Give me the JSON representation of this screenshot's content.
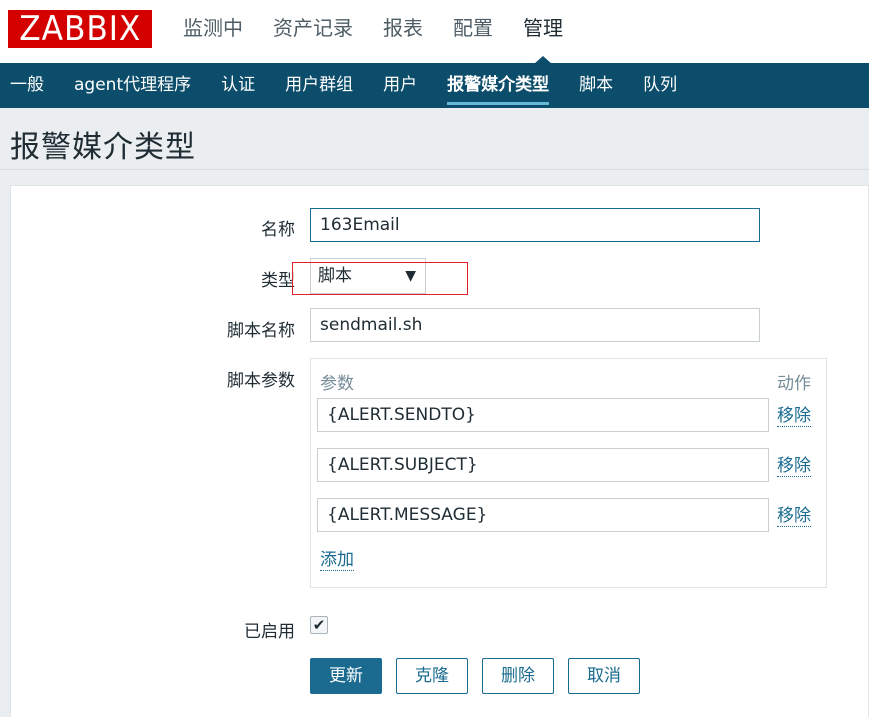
{
  "header": {
    "logo": "ZABBIX",
    "menu": [
      "监测中",
      "资产记录",
      "报表",
      "配置",
      "管理"
    ],
    "active_menu": "管理"
  },
  "subnav": {
    "items": [
      "一般",
      "agent代理程序",
      "认证",
      "用户群组",
      "用户",
      "报警媒介类型",
      "脚本",
      "队列"
    ],
    "active": "报警媒介类型"
  },
  "page": {
    "title": "报警媒介类型"
  },
  "form": {
    "name_label": "名称",
    "name_value": "163Email",
    "type_label": "类型",
    "type_value": "脚本",
    "script_name_label": "脚本名称",
    "script_name_value": "sendmail.sh",
    "script_params_label": "脚本参数",
    "params_col_header": "参数",
    "action_col_header": "动作",
    "params": [
      {
        "value": "{ALERT.SENDTO}",
        "action": "移除"
      },
      {
        "value": "{ALERT.SUBJECT}",
        "action": "移除"
      },
      {
        "value": "{ALERT.MESSAGE}",
        "action": "移除"
      }
    ],
    "add_link": "添加",
    "enabled_label": "已启用",
    "enabled": true
  },
  "buttons": {
    "update": "更新",
    "clone": "克隆",
    "delete": "删除",
    "cancel": "取消"
  },
  "colors": {
    "brand_red": "#d40000",
    "nav_blue": "#0b4d6a",
    "accent": "#1a6b8f",
    "annotation_red": "#e0202a"
  }
}
